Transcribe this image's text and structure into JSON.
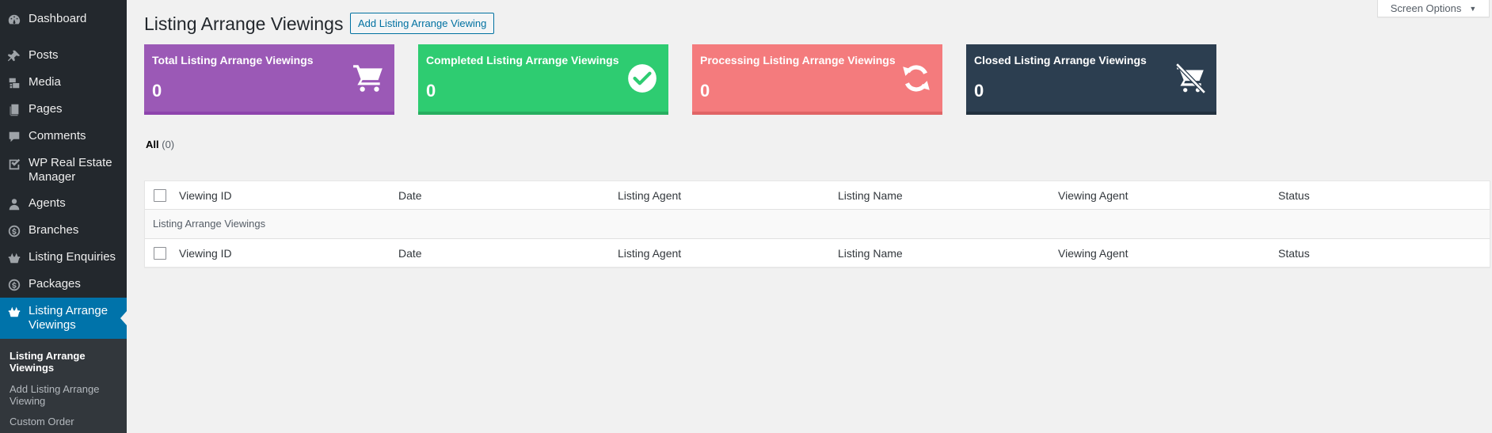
{
  "sidebar": {
    "items": [
      {
        "label": "Dashboard",
        "icon": "dashboard-icon"
      },
      {
        "label": "Posts",
        "icon": "pushpin-icon"
      },
      {
        "label": "Media",
        "icon": "media-icon"
      },
      {
        "label": "Pages",
        "icon": "pages-icon"
      },
      {
        "label": "Comments",
        "icon": "comment-icon"
      },
      {
        "label": "WP Real Estate Manager",
        "icon": "checklist-icon"
      },
      {
        "label": "Agents",
        "icon": "user-icon"
      },
      {
        "label": "Branches",
        "icon": "coin-icon"
      },
      {
        "label": "Listing Enquiries",
        "icon": "basket-icon"
      },
      {
        "label": "Packages",
        "icon": "coin-icon"
      },
      {
        "label": "Listing Arrange Viewings",
        "icon": "basket-icon",
        "current": true
      }
    ],
    "submenu": [
      {
        "label": "Listing Arrange Viewings",
        "current": true
      },
      {
        "label": "Add Listing Arrange Viewing"
      },
      {
        "label": "Custom Order"
      }
    ]
  },
  "screen_options": {
    "label": "Screen Options",
    "caret": "▼"
  },
  "page": {
    "title": "Listing Arrange Viewings",
    "add_new_label": "Add Listing Arrange Viewing"
  },
  "stats": [
    {
      "title": "Total Listing Arrange Viewings",
      "count": "0",
      "icon": "cart-icon",
      "color": "#9b59b6"
    },
    {
      "title": "Completed Listing Arrange Viewings",
      "count": "0",
      "icon": "checkmark-circle-icon",
      "color": "#2ecc71"
    },
    {
      "title": "Processing Listing Arrange Viewings",
      "count": "0",
      "icon": "refresh-icon",
      "color": "#f47b7d"
    },
    {
      "title": "Closed Listing Arrange Viewings",
      "count": "0",
      "icon": "cart-off-icon",
      "color": "#2c3e50"
    }
  ],
  "filters": {
    "all_label": "All",
    "all_count": "(0)"
  },
  "table": {
    "columns": [
      "Viewing ID",
      "Date",
      "Listing Agent",
      "Listing Name",
      "Viewing Agent",
      "Status"
    ],
    "empty_message": "Listing Arrange Viewings"
  }
}
